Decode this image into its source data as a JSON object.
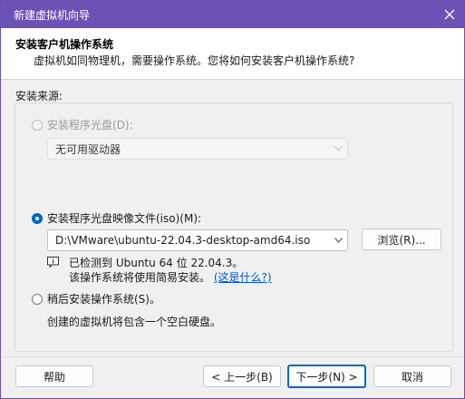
{
  "window": {
    "title": "新建虚拟机向导",
    "close_icon": "close-icon",
    "accent": "#6b52b5"
  },
  "header": {
    "title": "安装客户机操作系统",
    "subtitle": "虚拟机如同物理机，需要操作系统。您将如何安装客户机操作系统?"
  },
  "source": {
    "label": "安装来源:",
    "options": {
      "disc": {
        "label": "安装程序光盘(D):",
        "selected": false,
        "enabled": false
      },
      "iso": {
        "label": "安装程序光盘映像文件(iso)(M):",
        "selected": true,
        "enabled": true
      },
      "later": {
        "label": "稍后安装操作系统(S)。",
        "selected": false,
        "enabled": true
      }
    },
    "disc_drive": {
      "value": "无可用驱动器"
    },
    "iso_path": {
      "value": "D:\\VMware\\ubuntu-22.04.3-desktop-amd64.iso"
    },
    "browse_label": "浏览(R)...",
    "detect_line": "已检测到 Ubuntu 64 位 22.04.3。",
    "easy_install_text": "该操作系统将使用简易安装。",
    "easy_install_link": "(这是什么?)",
    "later_desc": "创建的虚拟机将包含一个空白硬盘。"
  },
  "footer": {
    "help": "帮助",
    "back": "< 上一步(B)",
    "next": "下一步(N) >",
    "cancel": "取消"
  }
}
